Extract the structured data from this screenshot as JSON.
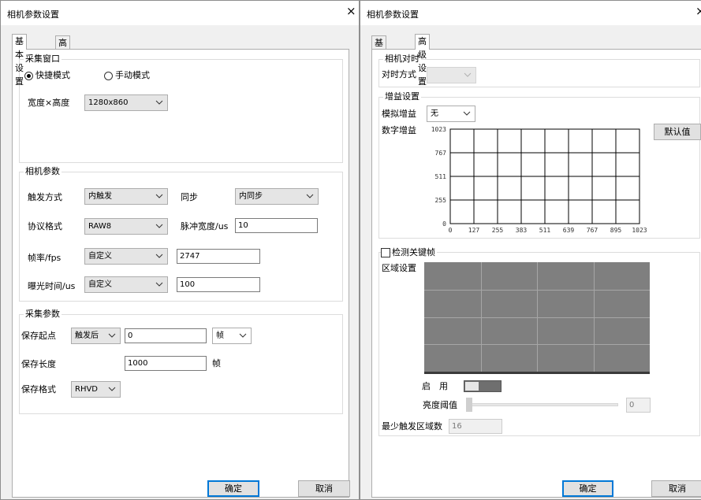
{
  "left_dialog": {
    "title": "相机参数设置",
    "close_symbol": "×",
    "tabs": {
      "basic": "基本设置",
      "advanced": "高级设置"
    },
    "capture_window": {
      "title": "采集窗口",
      "radio_quick": "快捷模式",
      "radio_manual": "手动模式",
      "size_label": "宽度×高度",
      "size_value": "1280x860"
    },
    "camera_params": {
      "title": "相机参数",
      "trigger_label": "触发方式",
      "trigger_value": "内触发",
      "sync_label": "同步",
      "sync_value": "内同步",
      "protocol_label": "协议格式",
      "protocol_value": "RAW8",
      "pulse_label": "脉冲宽度/us",
      "pulse_value": "10",
      "framerate_label": "帧率/fps",
      "framerate_mode": "自定义",
      "framerate_value": "2747",
      "exposure_label": "曝光时间/us",
      "exposure_mode": "自定义",
      "exposure_value": "100"
    },
    "capture_params": {
      "title": "采集参数",
      "start_label": "保存起点",
      "start_mode": "触发后",
      "start_value": "0",
      "start_unit": "帧",
      "length_label": "保存长度",
      "length_value": "1000",
      "length_unit": "帧",
      "format_label": "保存格式",
      "format_value": "RHVD"
    },
    "ok_label": "确定",
    "cancel_label": "取消"
  },
  "right_dialog": {
    "title": "相机参数设置",
    "close_symbol": "×",
    "tabs": {
      "basic": "基本设置",
      "advanced": "高级设置"
    },
    "time_sync": {
      "title": "相机对时",
      "method_label": "对时方式",
      "method_value": ""
    },
    "gain": {
      "title": "增益设置",
      "analog_label": "模拟增益",
      "analog_value": "无",
      "digital_label": "数字增益",
      "default_button": "默认值"
    },
    "keyframe": {
      "checkbox_label": "检测关键帧",
      "checked": false,
      "region_label": "区域设置",
      "enable_label": "启　用",
      "enabled": false,
      "brightness_label": "亮度阈值",
      "brightness_value": "0",
      "min_regions_label": "最少触发区域数",
      "min_regions_value": "16"
    },
    "ok_label": "确定",
    "cancel_label": "取消"
  },
  "chart_data": {
    "type": "line",
    "title": "",
    "xlabel": "",
    "ylabel": "",
    "xlim": [
      0,
      1023
    ],
    "ylim": [
      0,
      1023
    ],
    "x_ticks": [
      "0",
      "127",
      "255",
      "383",
      "511",
      "639",
      "767",
      "895",
      "1023"
    ],
    "y_ticks": [
      "0",
      "255",
      "511",
      "767",
      "1023"
    ],
    "grid": true,
    "series": []
  },
  "colors": {
    "dialog_bg": "#f0f0f0",
    "focus_blue": "#0078d7",
    "region_fill": "#7f7f7f",
    "region_grid": "#a6a6a6",
    "disabled_text": "#7a7a7a"
  }
}
